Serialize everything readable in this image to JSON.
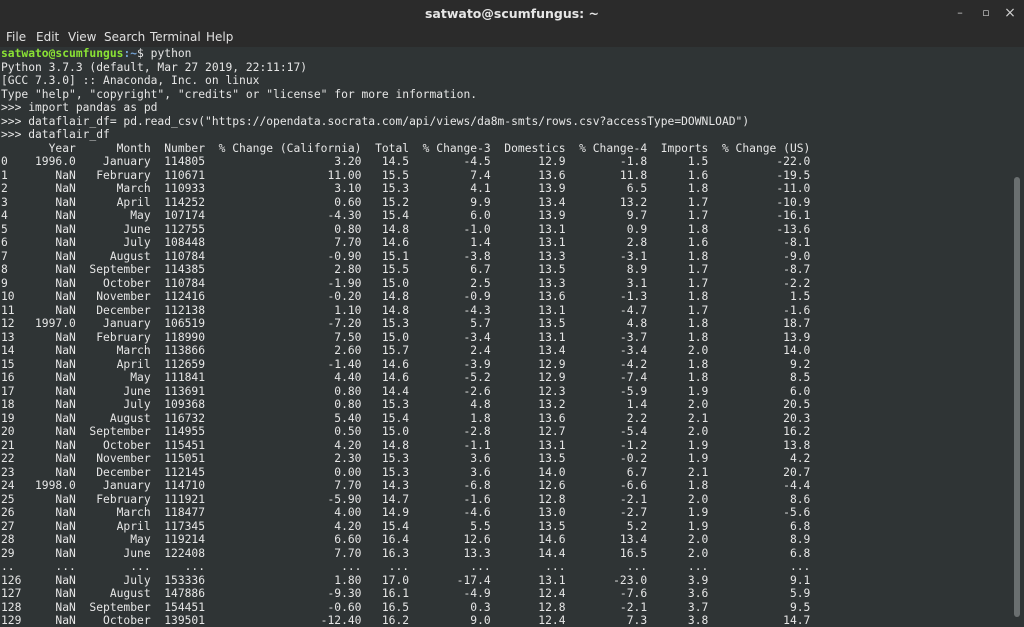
{
  "window": {
    "title": "satwato@scumfungus: ~",
    "minimize": "–",
    "maximize": "▫",
    "close": "×"
  },
  "menu": [
    "File",
    "Edit",
    "View",
    "Search",
    "Terminal",
    "Help"
  ],
  "prompt": {
    "user_host": "satwato@scumfungus",
    "path": ":~",
    "symbol": "$",
    "command": " python"
  },
  "lines": [
    "Python 3.7.3 (default, Mar 27 2019, 22:11:17)",
    "[GCC 7.3.0] :: Anaconda, Inc. on linux",
    "Type \"help\", \"copyright\", \"credits\" or \"license\" for more information.",
    ">>> import pandas as pd",
    ">>> dataflair_df= pd.read_csv(\"https://opendata.socrata.com/api/views/da8m-smts/rows.csv?accessType=DOWNLOAD\")",
    ">>> dataflair_df",
    "       Year      Month  Number  % Change (California)  Total  % Change-3  Domestics  % Change-4  Imports  % Change (US)",
    "0    1996.0    January  114805                   3.20   14.5        -4.5       12.9        -1.8      1.5          -22.0",
    "1       NaN   February  110671                  11.00   15.5         7.4       13.6        11.8      1.6          -19.5",
    "2       NaN      March  110933                   3.10   15.3         4.1       13.9         6.5      1.8          -11.0",
    "3       NaN      April  114252                   0.60   15.2         9.9       13.4        13.2      1.7          -10.9",
    "4       NaN        May  107174                  -4.30   15.4         6.0       13.9         9.7      1.7          -16.1",
    "5       NaN       June  112755                   0.80   14.8        -1.0       13.1         0.9      1.8          -13.6",
    "6       NaN       July  108448                   7.70   14.6         1.4       13.1         2.8      1.6           -8.1",
    "7       NaN     August  110784                  -0.90   15.1        -3.8       13.3        -3.1      1.8           -9.0",
    "8       NaN  September  114385                   2.80   15.5         6.7       13.5         8.9      1.7           -8.7",
    "9       NaN    October  110784                  -1.90   15.0         2.5       13.3         3.1      1.7           -2.2",
    "10      NaN   November  112416                  -0.20   14.8        -0.9       13.6        -1.3      1.8            1.5",
    "11      NaN   December  112138                   1.10   14.8        -4.3       13.1        -4.7      1.7           -1.6",
    "12   1997.0    January  106519                  -7.20   15.3         5.7       13.5         4.8      1.8           18.7",
    "13      NaN   February  118990                   7.50   15.0        -3.4       13.1        -3.7      1.8           13.9",
    "14      NaN      March  113866                   2.60   15.7         2.4       13.4        -3.4      2.0           14.0",
    "15      NaN      April  112659                  -1.40   14.6        -3.9       12.9        -4.2      1.8            9.2",
    "16      NaN        May  111841                   4.40   14.6        -5.2       12.9        -7.4      1.8            8.5",
    "17      NaN       June  113691                   0.80   14.4        -2.6       12.3        -5.9      1.9            6.0",
    "18      NaN       July  109368                   0.80   15.3         4.8       13.2         1.4      2.0           20.5",
    "19      NaN     August  116732                   5.40   15.4         1.8       13.6         2.2      2.1           20.3",
    "20      NaN  September  114955                   0.50   15.0        -2.8       12.7        -5.4      2.0           16.2",
    "21      NaN    October  115451                   4.20   14.8        -1.1       13.1        -1.2      1.9           13.8",
    "22      NaN   November  115051                   2.30   15.3         3.6       13.5        -0.2      1.9            4.2",
    "23      NaN   December  112145                   0.00   15.3         3.6       14.0         6.7      2.1           20.7",
    "24   1998.0    January  114710                   7.70   14.3        -6.8       12.6        -6.6      1.8           -4.4",
    "25      NaN   February  111921                  -5.90   14.7        -1.6       12.8        -2.1      2.0            8.6",
    "26      NaN      March  118477                   4.00   14.9        -4.6       13.0        -2.7      1.9           -5.6",
    "27      NaN      April  117345                   4.20   15.4         5.5       13.5         5.2      1.9            6.8",
    "28      NaN        May  119214                   6.60   16.4        12.6       14.6        13.4      2.0            8.9",
    "29      NaN       June  122408                   7.70   16.3        13.3       14.4        16.5      2.0            6.8",
    "..      ...        ...     ...                    ...    ...         ...        ...         ...      ...            ...",
    "126     NaN       July  153336                   1.80   17.0       -17.4       13.1       -23.0      3.9            9.1",
    "127     NaN     August  147886                  -9.30   16.1        -4.9       12.4        -7.6      3.6            5.9",
    "128     NaN  September  154451                  -0.60   16.5         0.3       12.8        -2.1      3.7            9.5",
    "129     NaN    October  139501                 -12.40   16.2         9.0       12.4         7.3      3.8           14.7"
  ]
}
